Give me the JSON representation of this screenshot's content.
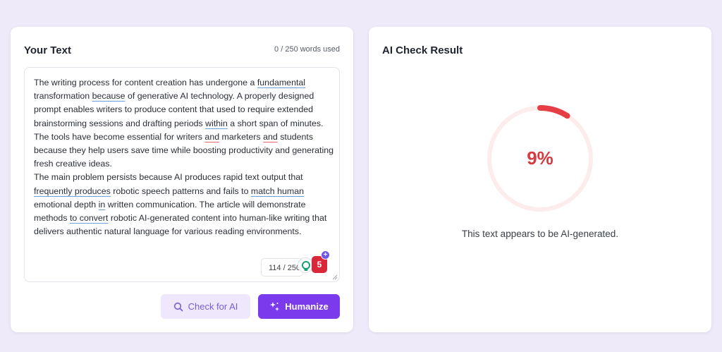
{
  "left_panel": {
    "title": "Your Text",
    "word_usage": "0 / 250 words used",
    "paragraph1": [
      {
        "t": "The writing process for content creation has undergone a ",
        "u": ""
      },
      {
        "t": "fundamental",
        "u": "blue"
      },
      {
        "t": " transformation ",
        "u": ""
      },
      {
        "t": "because",
        "u": "blue"
      },
      {
        "t": " of generative AI technology. A properly designed prompt enables writers to produce content that used to require extended brainstorming sessions and drafting periods ",
        "u": ""
      },
      {
        "t": "within",
        "u": "blue"
      },
      {
        "t": " a short span of minutes. The tools have become essential for writers ",
        "u": ""
      },
      {
        "t": "and",
        "u": "red"
      },
      {
        "t": " marketers ",
        "u": ""
      },
      {
        "t": "and",
        "u": "red"
      },
      {
        "t": " students because they help users save time while boosting productivity and generating fresh creative ideas.",
        "u": ""
      }
    ],
    "paragraph2": [
      {
        "t": "The main problem persists because AI produces rapid text output that ",
        "u": ""
      },
      {
        "t": "frequently produces",
        "u": "blue"
      },
      {
        "t": " robotic speech patterns and fails to ",
        "u": ""
      },
      {
        "t": "match human",
        "u": "blue"
      },
      {
        "t": " emotional depth ",
        "u": ""
      },
      {
        "t": "in",
        "u": "blue"
      },
      {
        "t": " written communication. The article will demonstrate methods ",
        "u": ""
      },
      {
        "t": "to convert",
        "u": "blue"
      },
      {
        "t": " robotic AI-generated content into human-like writing that delivers authentic natural language for various reading environments.",
        "u": ""
      }
    ],
    "counter": "114 / 250",
    "extension_badge_count": "5",
    "extension_plus": "+",
    "check_button_label": "Check for AI",
    "humanize_button_label": "Humanize"
  },
  "right_panel": {
    "title": "AI Check Result",
    "score_label": "9%",
    "score_percent": 9,
    "result_text": "This text appears to be AI-generated."
  },
  "colors": {
    "accent": "#7c3aed",
    "accent_light": "#efe8fd",
    "gauge_fill": "#e53e45",
    "gauge_track": "#fdecec",
    "score_text": "#d63b42",
    "spell_blue": "#6d9fe0",
    "spell_red": "#e06b6b"
  },
  "icons": {
    "check_button_icon": "search-icon",
    "humanize_button_icon": "sparkle-icon",
    "extension_icon_1": "lightbulb-icon",
    "extension_icon_2": "badge-icon"
  }
}
